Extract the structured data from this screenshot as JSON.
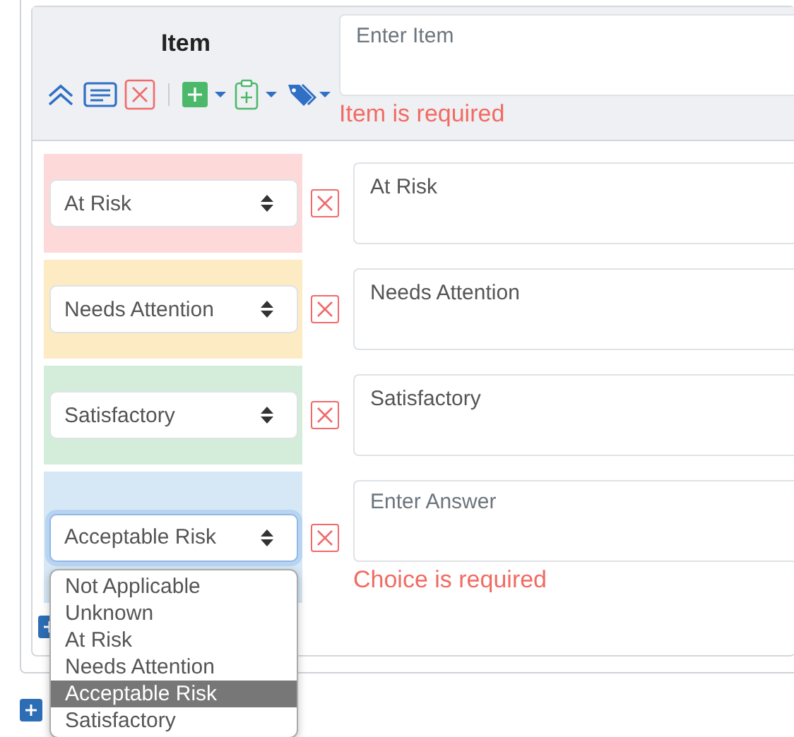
{
  "item": {
    "title": "Item",
    "field": {
      "placeholder": "Enter Item"
    },
    "error": "Item is required"
  },
  "choices": [
    {
      "value": "At Risk",
      "color": "#fdd9d9",
      "focused": false,
      "answer": {
        "value": "At Risk"
      }
    },
    {
      "value": "Needs Attention",
      "color": "#fdebc3",
      "focused": false,
      "answer": {
        "value": "Needs Attention"
      }
    },
    {
      "value": "Satisfactory",
      "color": "#d4edda",
      "focused": false,
      "answer": {
        "value": "Satisfactory"
      }
    },
    {
      "value": "Acceptable Risk",
      "color": "#d6e8f6",
      "focused": true,
      "answer": {
        "placeholder": "Enter Answer"
      },
      "error": "Choice is required"
    }
  ],
  "dropdown": {
    "options": [
      {
        "label": "Not Applicable",
        "selected": false
      },
      {
        "label": "Unknown",
        "selected": false
      },
      {
        "label": "At Risk",
        "selected": false
      },
      {
        "label": "Needs Attention",
        "selected": false
      },
      {
        "label": "Acceptable Risk",
        "selected": true
      },
      {
        "label": "Satisfactory",
        "selected": false
      }
    ]
  }
}
